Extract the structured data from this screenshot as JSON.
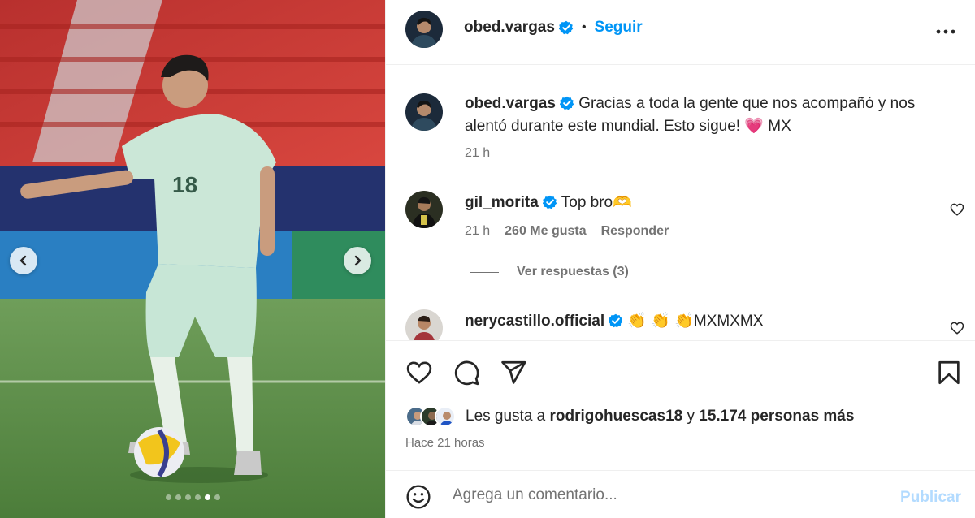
{
  "post": {
    "author": "obed.vargas",
    "follow_label": "Seguir",
    "separator": "•"
  },
  "media": {
    "jersey_number": "18",
    "slide_count": 6,
    "active_slide": 5
  },
  "comments": [
    {
      "username": "obed.vargas",
      "verified": true,
      "text": "Gracias a toda la gente que nos acompañó y nos alentó durante este mundial. Esto sigue! 💗 MX",
      "time": "21 h"
    },
    {
      "username": "gil_morita",
      "verified": true,
      "text": "Top bro🫶",
      "time": "21 h",
      "likes": "260 Me gusta",
      "reply_label": "Responder",
      "view_replies": "Ver respuestas (3)"
    },
    {
      "username": "nerycastillo.official",
      "verified": true,
      "text": "👏 👏 👏MXMXMX"
    }
  ],
  "likes_summary": {
    "prefix": "Les gusta a",
    "user": "rodrigohuescas18",
    "conjunction": "y",
    "others": "15.174 personas más"
  },
  "posted_ago": "Hace 21 horas",
  "comment_box": {
    "placeholder": "Agrega un comentario...",
    "publish_label": "Publicar"
  },
  "icons": {
    "like": "heart-icon",
    "comment": "comment-bubble-icon",
    "share": "paper-plane-icon",
    "save": "bookmark-icon",
    "more": "more-options-icon",
    "emoji": "emoji-icon",
    "verified": "verified-badge-icon"
  },
  "colors": {
    "accent": "#0095f6",
    "verified": "#0095f6",
    "publish_disabled": "#b3dbff",
    "muted": "#737373"
  }
}
